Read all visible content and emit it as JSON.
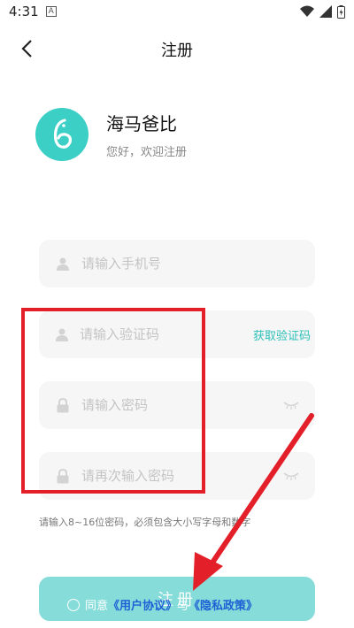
{
  "status": {
    "time": "4:31",
    "notif_letter": "A"
  },
  "nav": {
    "title": "注册"
  },
  "brand": {
    "name": "海马爸比",
    "subtitle": "您好，欢迎注册"
  },
  "form": {
    "phone_placeholder": "请输入手机号",
    "code_placeholder": "请输入验证码",
    "get_code_label": "获取验证码",
    "password_placeholder": "请输入密码",
    "confirm_placeholder": "请再次输入密码",
    "hint": "请输入8~16位密码，必须包含大小写字母和数字"
  },
  "register": {
    "label": "注册"
  },
  "agreement": {
    "prefix": "同意",
    "user_agreement": "《用户协议》",
    "and": "与",
    "privacy_policy": "《隐私政策》"
  },
  "colors": {
    "accent": "#3ccfc6",
    "annotation": "#e3202a",
    "link": "#1f5fd6"
  }
}
